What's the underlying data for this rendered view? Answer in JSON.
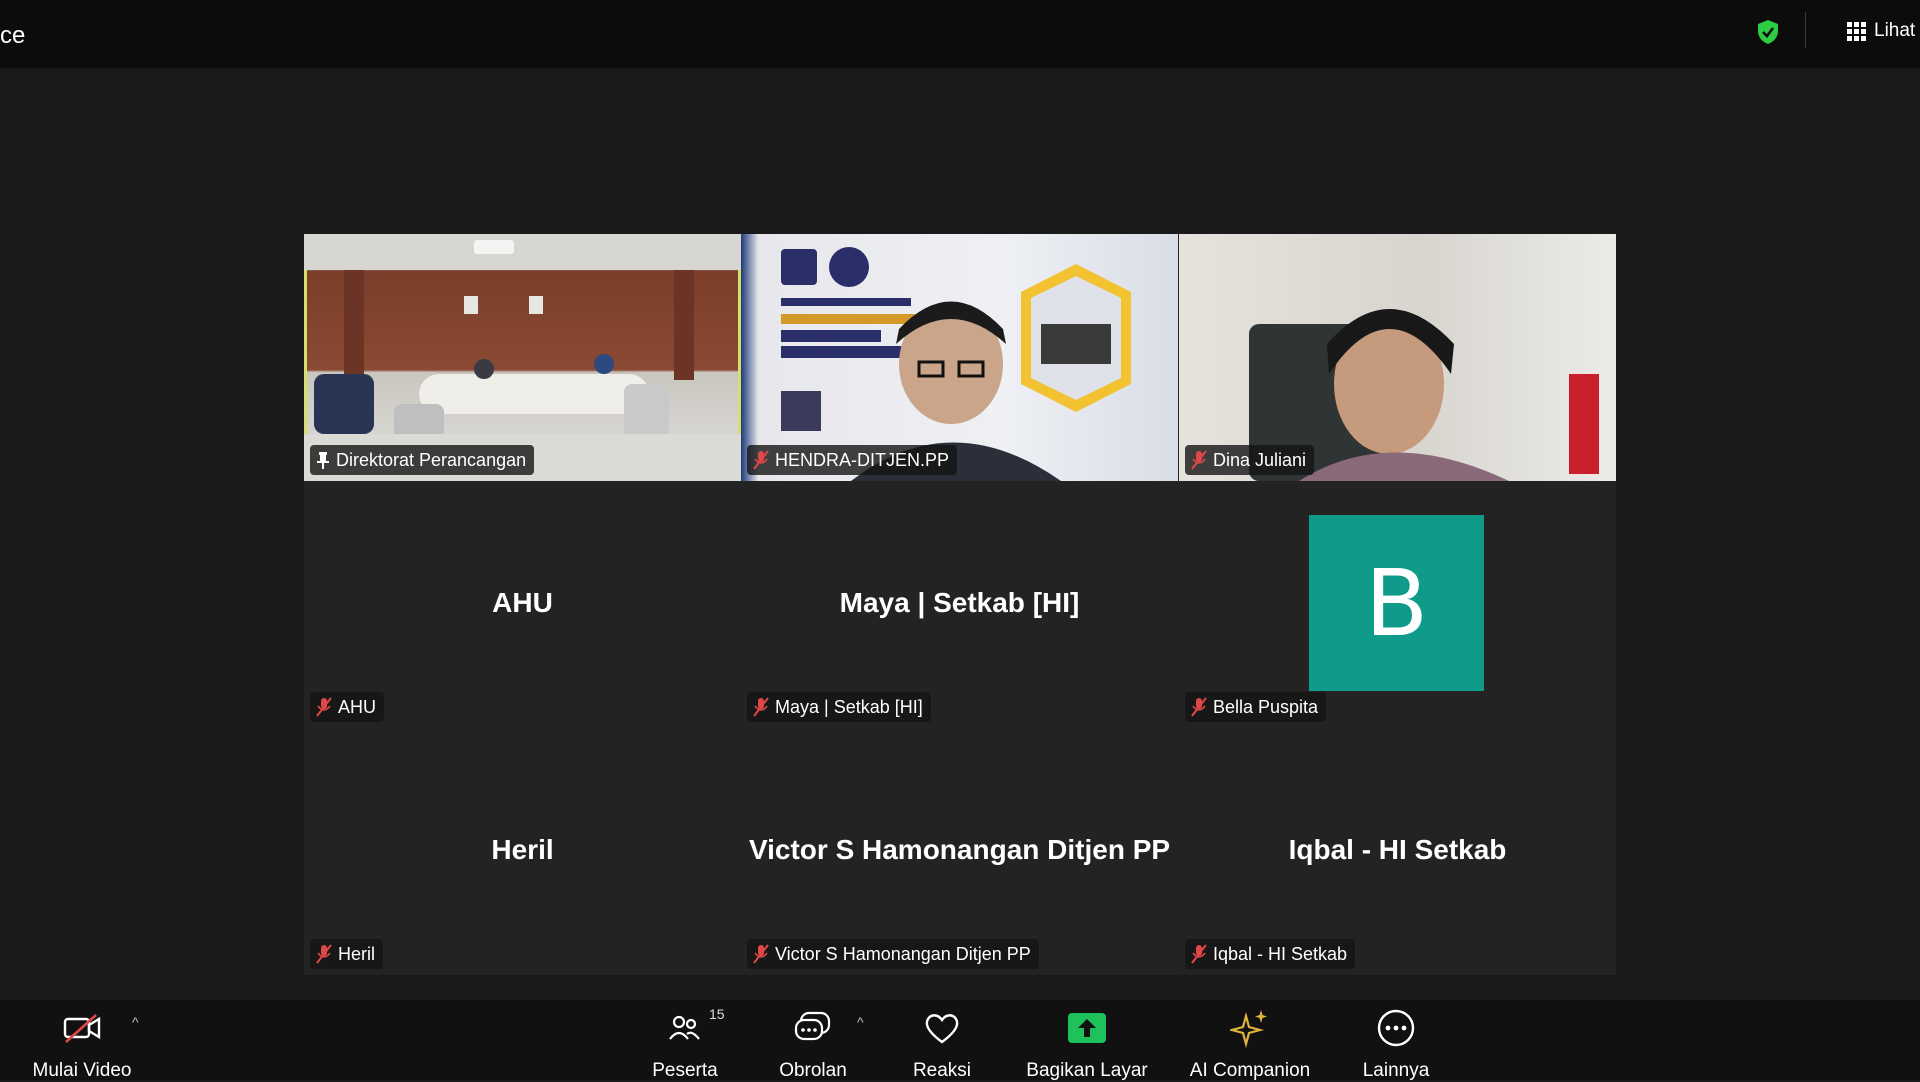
{
  "window": {
    "title_fragment": "ce"
  },
  "topbar": {
    "view_label": "Lihat",
    "security_icon": "shield-check-icon",
    "security_color": "#2ecc40"
  },
  "accent": {
    "active_speaker_border": "#d7df6a",
    "mic_muted": "#e04848",
    "share_green": "#1fc15a",
    "companion_gold": "#e2b33c"
  },
  "tiles": [
    {
      "name": "Direktorat Perancangan",
      "video": true,
      "pinned": true,
      "active": true
    },
    {
      "name": "HENDRA-DITJEN.PP",
      "video": true,
      "muted": true
    },
    {
      "name": "Dina Juliani",
      "video": true,
      "muted": true
    },
    {
      "name": "AHU",
      "display_name": "AHU",
      "muted": true
    },
    {
      "name": "Maya | Setkab [HI]",
      "display_name": "Maya | Setkab [HI]",
      "muted": true
    },
    {
      "name": "Bella Puspita",
      "avatar_letter": "B",
      "avatar_color": "#0f9b8a",
      "muted": true
    },
    {
      "name": "Heril",
      "display_name": "Heril",
      "muted": true
    },
    {
      "name": "Victor S Hamonangan Ditjen PP",
      "display_name": "Victor S Hamonangan Ditjen PP",
      "muted": true
    },
    {
      "name": "Iqbal - HI Setkab",
      "display_name": "Iqbal - HI Setkab",
      "muted": true
    }
  ],
  "toolbar": {
    "video": {
      "label": "Mulai Video",
      "icon": "video-off-icon"
    },
    "participants": {
      "label": "Peserta",
      "count": "15",
      "icon": "participants-icon"
    },
    "chat": {
      "label": "Obrolan",
      "icon": "chat-icon"
    },
    "reactions": {
      "label": "Reaksi",
      "icon": "heart-icon"
    },
    "share": {
      "label": "Bagikan Layar",
      "icon": "share-screen-icon"
    },
    "ai": {
      "label": "AI Companion",
      "icon": "sparkle-icon"
    },
    "more": {
      "label": "Lainnya",
      "icon": "more-icon"
    }
  }
}
